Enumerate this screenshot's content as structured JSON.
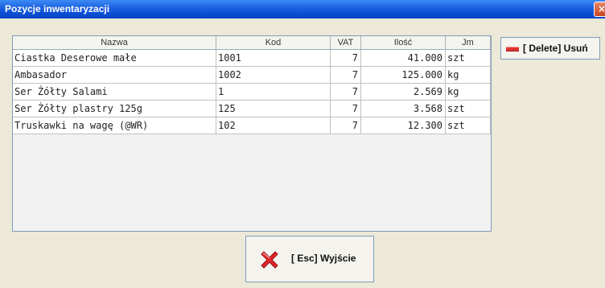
{
  "window": {
    "title": "Pozycje inwentaryzacji",
    "close_label": "×"
  },
  "table": {
    "columns": [
      "Nazwa",
      "Kod",
      "VAT",
      "Ilość",
      "Jm"
    ],
    "rows": [
      [
        "Ciastka Deserowe małe",
        "1001",
        "7",
        "41.000",
        "szt"
      ],
      [
        "Ambasador",
        "1002",
        "7",
        "125.000",
        "kg"
      ],
      [
        "Ser Żółty Salami",
        "1",
        "7",
        "2.569",
        "kg"
      ],
      [
        "Ser Żółty plastry 125g",
        "125",
        "7",
        "3.568",
        "szt"
      ],
      [
        "Truskawki na wagę (@WR)",
        "102",
        "7",
        "12.300",
        "szt"
      ]
    ]
  },
  "buttons": {
    "delete_label": "[ Delete] Usuń",
    "delete_icon": "minus-icon",
    "exit_label": "[ Esc] Wyjście",
    "exit_icon": "red-x-icon"
  },
  "colors": {
    "titlebar": "#0a4fd6",
    "background": "#ece9d8",
    "delete_icon": "#d33333",
    "exit_icon": "#e0262b"
  }
}
